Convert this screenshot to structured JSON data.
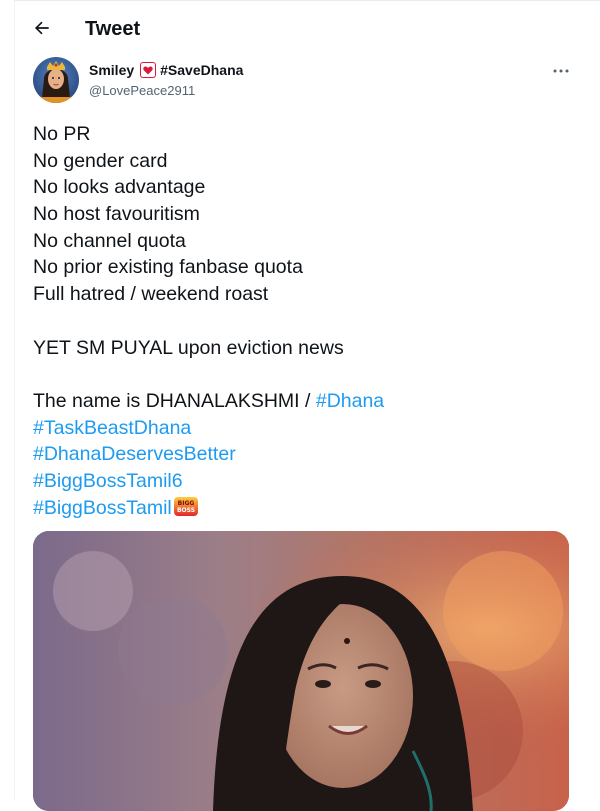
{
  "header": {
    "title": "Tweet"
  },
  "author": {
    "name": "Smiley",
    "name_suffix": "#SaveDhana",
    "handle": "@LovePeace2911"
  },
  "tweet": {
    "lines": [
      "No PR",
      "No gender card",
      "No looks advantage",
      "No host favouritism",
      "No channel quota",
      "No prior existing fanbase quota",
      "Full hatred / weekend roast"
    ],
    "line_2": "YET SM PUYAL upon eviction news",
    "line_3_prefix": "The name is DHANALAKSHMI / ",
    "hashtags": [
      "#Dhana",
      "#TaskBeastDhana",
      "#DhanaDeservesBetter",
      "#BiggBossTamil6",
      "#BiggBossTamil"
    ],
    "emoji_badge_text": [
      "BIGG",
      "BOSS"
    ]
  },
  "colors": {
    "link": "#1d9bf0",
    "text": "#0f1419",
    "muted": "#536471",
    "heart": "#d81b3c"
  }
}
